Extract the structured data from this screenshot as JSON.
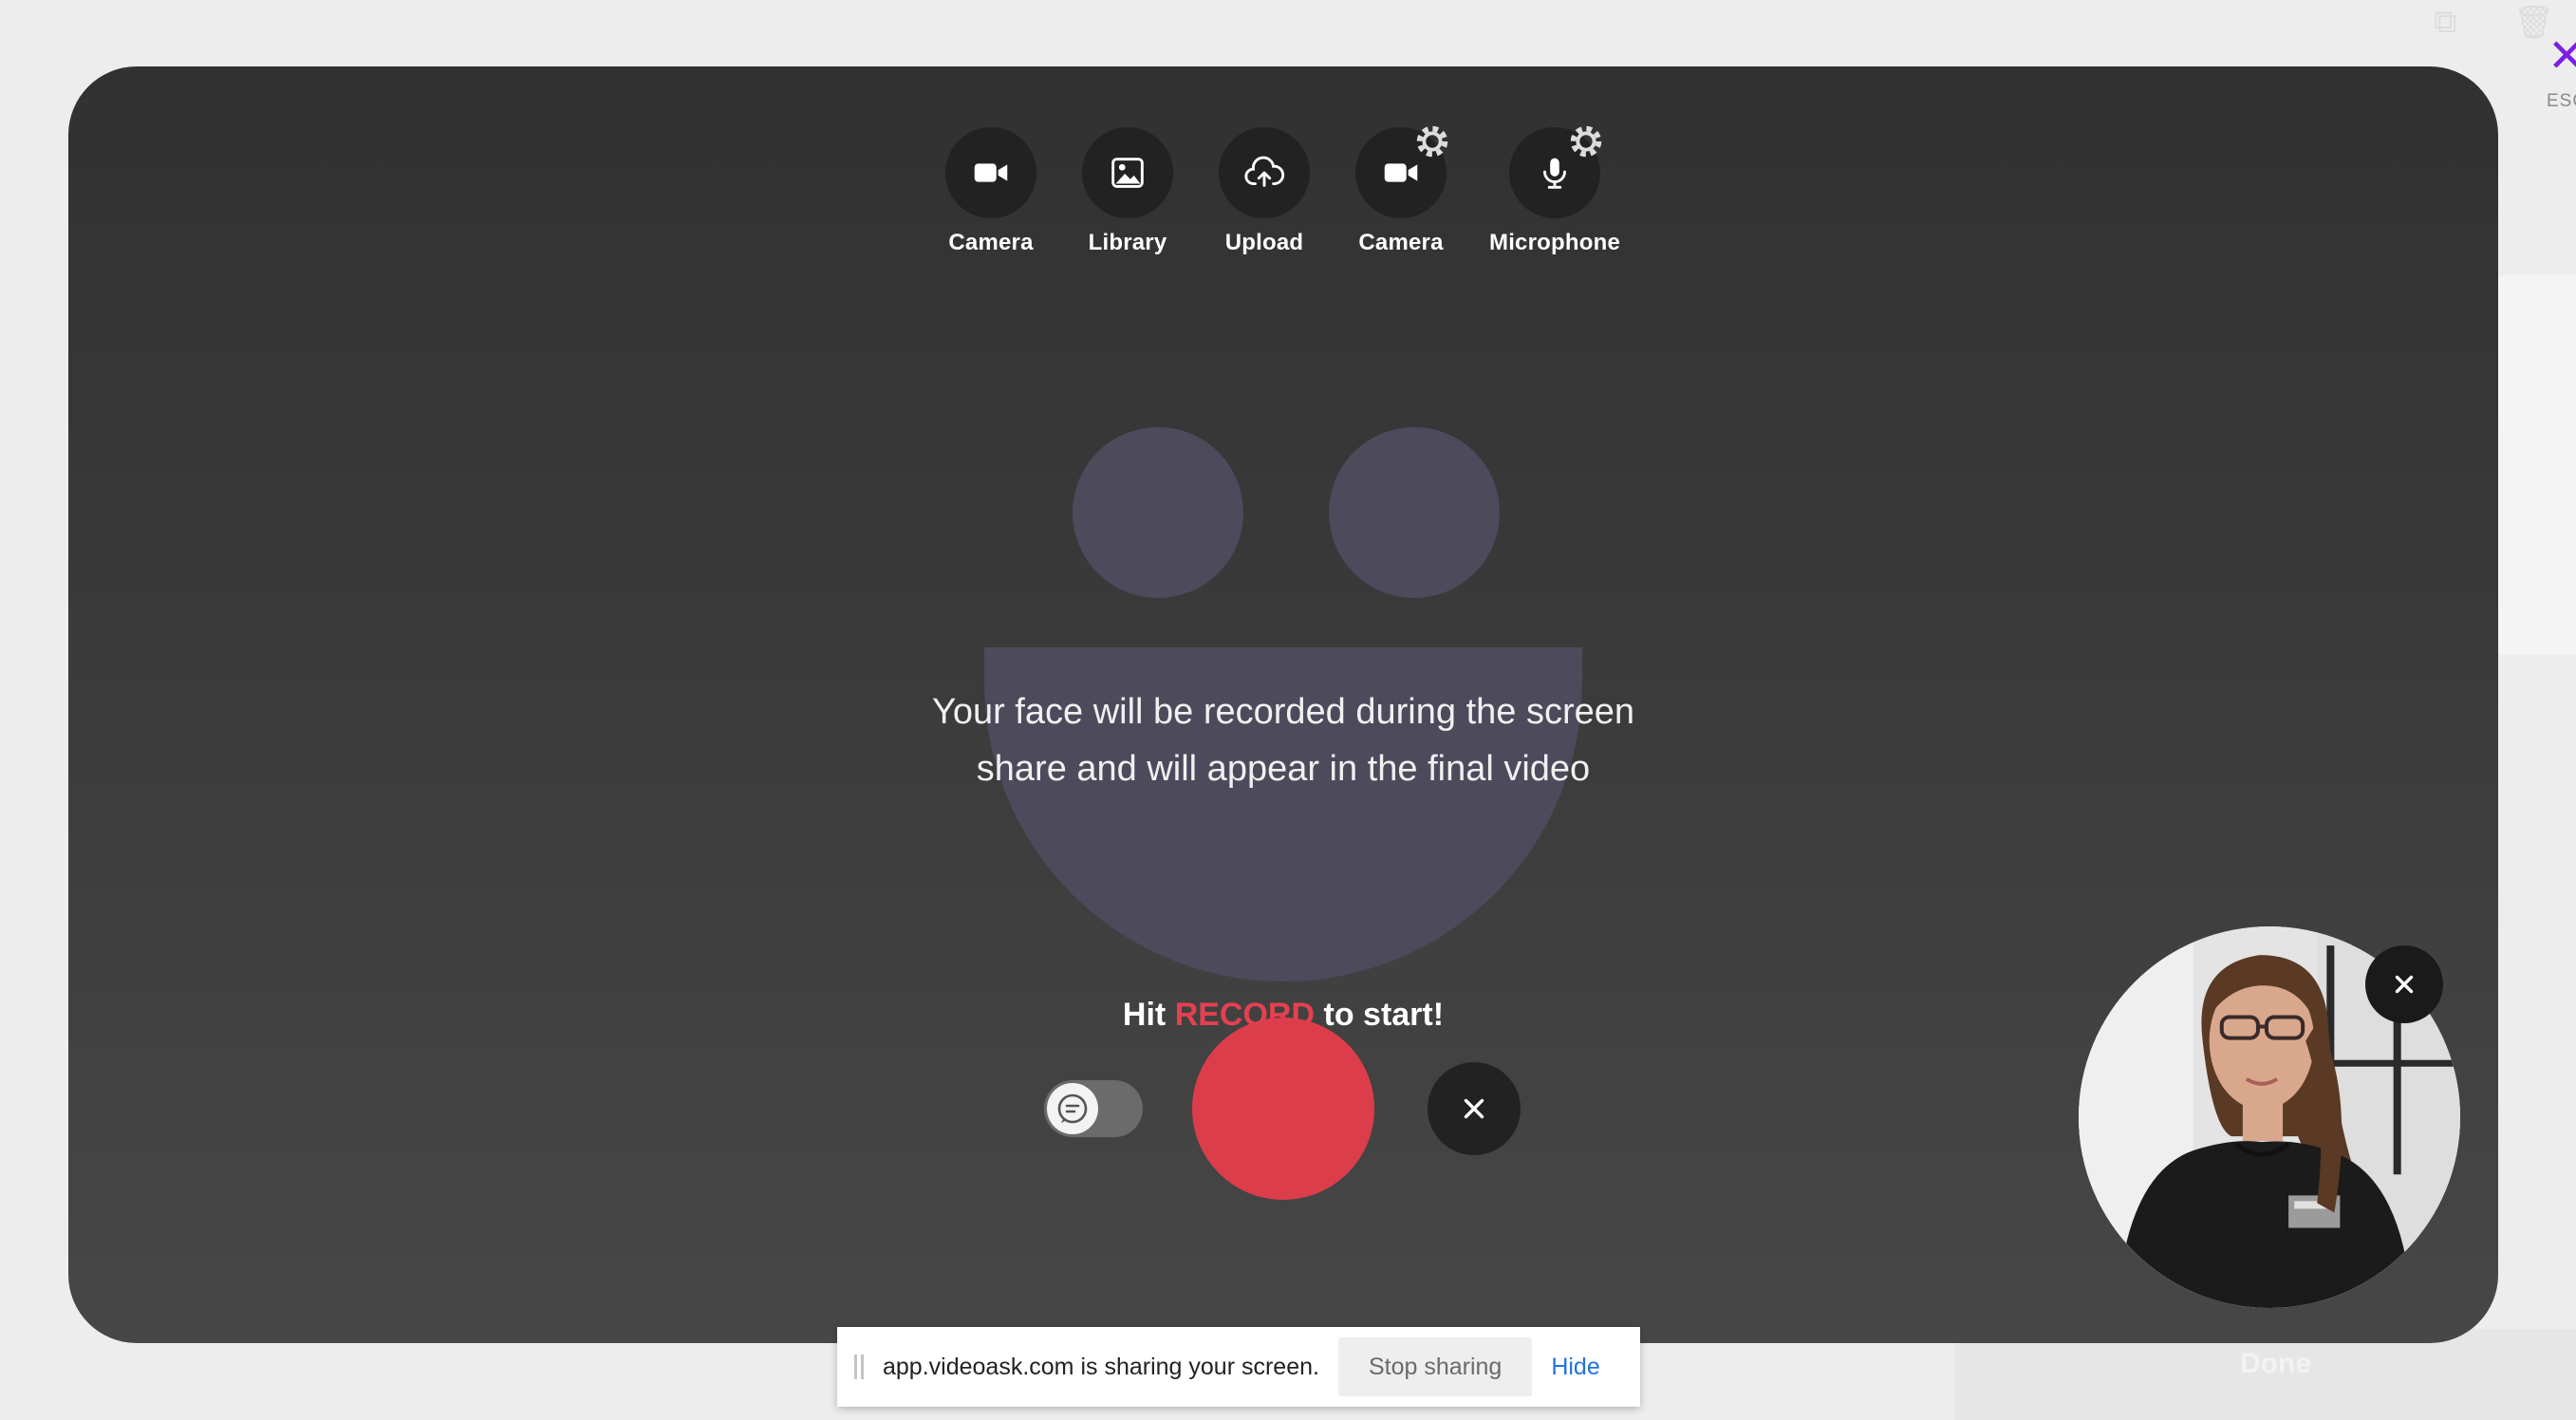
{
  "background": {
    "esc_label": "ESC",
    "done_label": "Done"
  },
  "toolbar": {
    "items": [
      {
        "label": "Camera",
        "icon": "video-camera-icon"
      },
      {
        "label": "Library",
        "icon": "image-icon"
      },
      {
        "label": "Upload",
        "icon": "cloud-upload-icon"
      },
      {
        "label": "Camera",
        "icon": "video-camera-icon",
        "settings": true
      },
      {
        "label": "Microphone",
        "icon": "microphone-icon",
        "settings": true
      }
    ]
  },
  "main": {
    "message": "Your face will be recorded during the screen share and will appear in the final video",
    "hint_prefix": "Hit",
    "hint_emphasis": "RECORD",
    "hint_suffix": "to start!"
  },
  "colors": {
    "record": "#dc3d4b",
    "accent_text": "#e5404f",
    "face_shape": "#4d4a5c",
    "esc_close": "#7a22e0",
    "hide_link": "#2272e0"
  },
  "sharebar": {
    "text": "app.videoask.com is sharing your screen.",
    "stop_label": "Stop sharing",
    "hide_label": "Hide"
  }
}
